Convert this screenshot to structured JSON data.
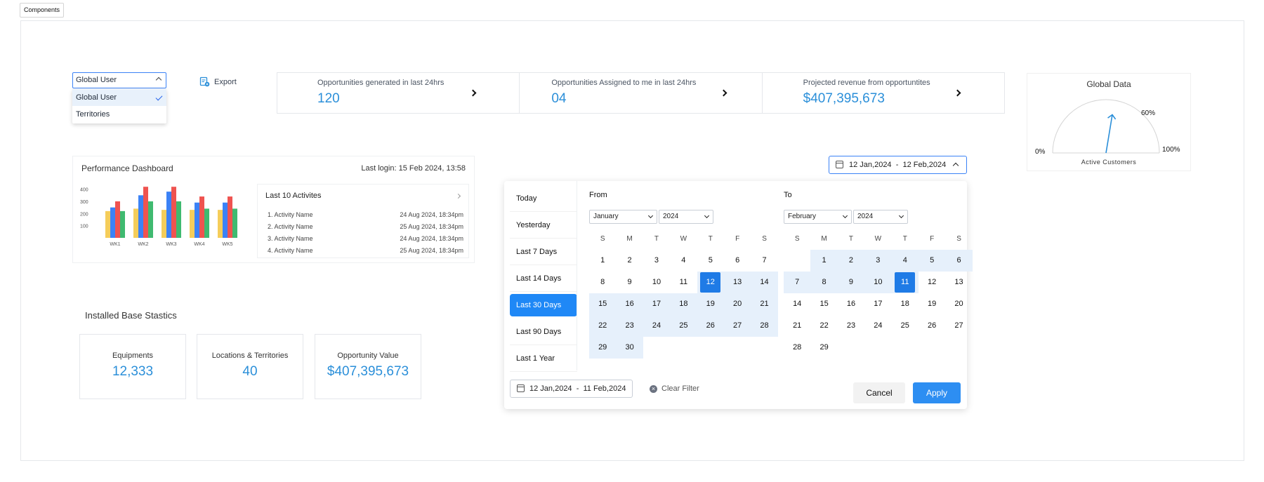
{
  "tab": {
    "label": "Components"
  },
  "user_select": {
    "value": "Global User",
    "options": [
      "Global User",
      "Territories"
    ],
    "selected_index": 0
  },
  "export": {
    "label": "Export"
  },
  "stats": [
    {
      "label": "Opportunities generated in last 24hrs",
      "value": "120"
    },
    {
      "label": "Opportunities Assigned to me in last 24hrs",
      "value": "04"
    },
    {
      "label": "Projected revenue from opportuntites",
      "value": "$407,395,673"
    }
  ],
  "gauge": {
    "title": "Global Data",
    "min_label": "0%",
    "max_label": "100%",
    "value_label": "60%",
    "value": 60,
    "caption": "Active Customers",
    "color": "#2b8fd9"
  },
  "performance": {
    "title": "Performance Dashboard",
    "last_login": "Last login: 15 Feb 2024, 13:58",
    "chart_data": {
      "type": "bar",
      "categories": [
        "WK1",
        "WK2",
        "WK3",
        "WK4",
        "WK5"
      ],
      "y_ticks": [
        "400",
        "300",
        "200",
        "100"
      ],
      "ylim": [
        0,
        450
      ],
      "series": [
        {
          "color": "#f5cd5a",
          "values": [
            220,
            240,
            230,
            230,
            230
          ]
        },
        {
          "color": "#3b82f6",
          "values": [
            250,
            350,
            380,
            290,
            290
          ]
        },
        {
          "color": "#ef5350",
          "values": [
            300,
            420,
            420,
            340,
            340
          ]
        },
        {
          "color": "#3fba70",
          "values": [
            220,
            300,
            300,
            240,
            240
          ]
        }
      ]
    },
    "activities": {
      "title": "Last 10 Activites",
      "items": [
        {
          "name": "1. Activity Name",
          "time": "24 Aug 2024, 18:34pm"
        },
        {
          "name": "2. Activity Name",
          "time": "25 Aug 2024, 18:34pm"
        },
        {
          "name": "3. Activity Name",
          "time": "24 Aug 2024, 18:34pm"
        },
        {
          "name": "4. Activity Name",
          "time": "25 Aug 2024, 18:34pm"
        }
      ]
    }
  },
  "installed": {
    "title": "Installed Base Stastics",
    "tiles": [
      {
        "label": "Equipments",
        "value": "12,333"
      },
      {
        "label": "Locations & Territories",
        "value": "40"
      },
      {
        "label": "Opportunity Value",
        "value": "$407,395,673"
      }
    ]
  },
  "date_range": {
    "trigger_from": "12 Jan,2024",
    "trigger_sep": "-",
    "trigger_to": "12 Feb,2024",
    "presets": [
      "Today",
      "Yesterday",
      "Last 7 Days",
      "Last 14 Days",
      "Last 30 Days",
      "Last 90 Days",
      "Last 1 Year"
    ],
    "active_preset": 4,
    "weekdays": [
      "S",
      "M",
      "T",
      "W",
      "T",
      "F",
      "S"
    ],
    "from": {
      "heading": "From",
      "month": "January",
      "year": "2024",
      "lead_blanks": 0,
      "days": 30,
      "selected": 12,
      "range_start": 12,
      "range_end": 30
    },
    "to": {
      "heading": "To",
      "month": "February",
      "year": "2024",
      "lead_blanks": 1,
      "days": 29,
      "selected": 11,
      "range_start": 1,
      "range_end": 11
    },
    "footer_from": "12 Jan,2024",
    "footer_sep": "-",
    "footer_to": "11 Feb,2024",
    "clear_label": "Clear Filter",
    "cancel_label": "Cancel",
    "apply_label": "Apply"
  }
}
